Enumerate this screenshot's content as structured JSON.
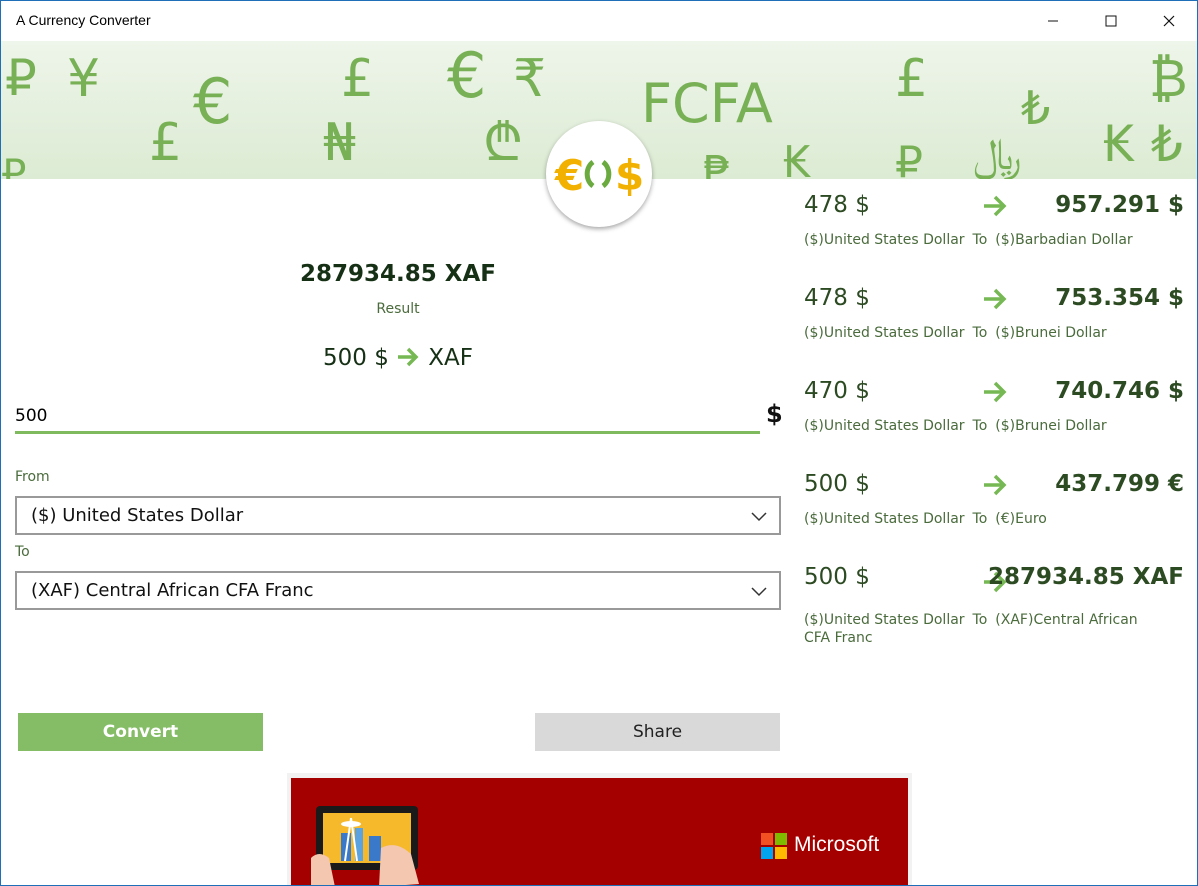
{
  "window": {
    "title": "A Currency Converter"
  },
  "banner": {
    "symbols": [
      "₽",
      "¥",
      "€",
      "£",
      "€",
      "₹",
      "FCFA",
      "£",
      "₿",
      "£",
      "₦",
      "₾",
      "₺",
      "₭",
      "₺",
      "₽",
      "₽",
      "₱",
      "₭",
      "﷼"
    ]
  },
  "converter": {
    "result_value": "287934.85 XAF",
    "result_label": "Result",
    "conversion_from": "500 $",
    "conversion_to": "XAF",
    "amount_value": "500",
    "amount_symbol": "$",
    "from_label": "From",
    "from_selected": "($) United States Dollar",
    "to_label": "To",
    "to_selected": "(XAF) Central African CFA Franc",
    "convert_label": "Convert",
    "share_label": "Share"
  },
  "history": [
    {
      "from": "478 $",
      "to": "957.291 $",
      "from_name": "($)United States Dollar",
      "to_word": "To",
      "to_name": "($)Barbadian Dollar"
    },
    {
      "from": "478 $",
      "to": "753.354 $",
      "from_name": "($)United States Dollar",
      "to_word": "To",
      "to_name": "($)Brunei Dollar"
    },
    {
      "from": "470 $",
      "to": "740.746 $",
      "from_name": "($)United States Dollar",
      "to_word": "To",
      "to_name": "($)Brunei Dollar"
    },
    {
      "from": "500 $",
      "to": "437.799 €",
      "from_name": "($)United States Dollar",
      "to_word": "To",
      "to_name": "(€)Euro"
    },
    {
      "from": "500 $",
      "to": "287934.85 XAF",
      "from_name": "($)United States Dollar",
      "to_word": "To",
      "to_name": "(XAF)Central African CFA Franc"
    }
  ],
  "ad": {
    "brand": "Microsoft"
  },
  "colors": {
    "accent": "#85bd67",
    "text_dark": "#2d4b23",
    "ad_bg": "#a50000"
  }
}
